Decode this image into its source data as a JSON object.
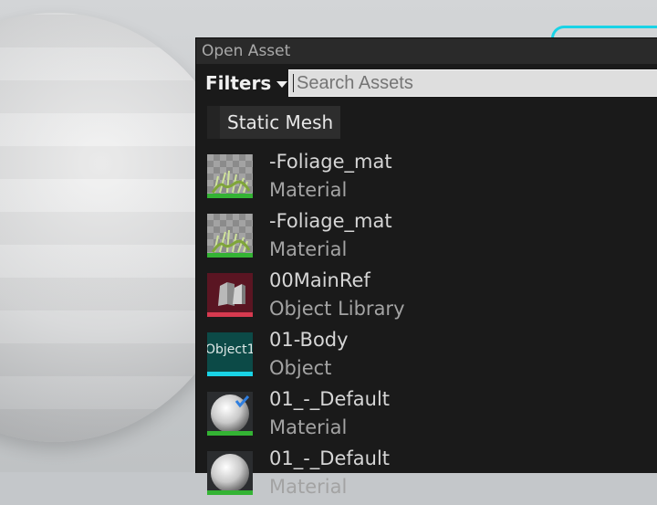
{
  "dialog": {
    "title": "Open Asset",
    "filters_label": "Filters",
    "search_placeholder": "Search Assets",
    "active_filter": "Static Mesh"
  },
  "assets": [
    {
      "name": "-Foliage_mat",
      "type": "Material",
      "thumb": "foliage",
      "bar_color": "#34b334"
    },
    {
      "name": "-Foliage_mat",
      "type": "Material",
      "thumb": "foliage",
      "bar_color": "#34b334"
    },
    {
      "name": "00MainRef",
      "type": "Object Library",
      "thumb": "object-library",
      "bar_color": "#d73a4f"
    },
    {
      "name": "01-Body",
      "type": "Object",
      "thumb": "object",
      "thumb_text": "Object1",
      "bar_color": "#19d3e6"
    },
    {
      "name": "01_-_Default",
      "type": "Material",
      "thumb": "material-sphere",
      "bar_color": "#34b334"
    },
    {
      "name": "01_-_Default",
      "type": "Material",
      "thumb": "material-sphere",
      "bar_color": "#34b334"
    }
  ],
  "colors": {
    "material": "#34b334",
    "object_library": "#d73a4f",
    "object": "#19d3e6"
  }
}
